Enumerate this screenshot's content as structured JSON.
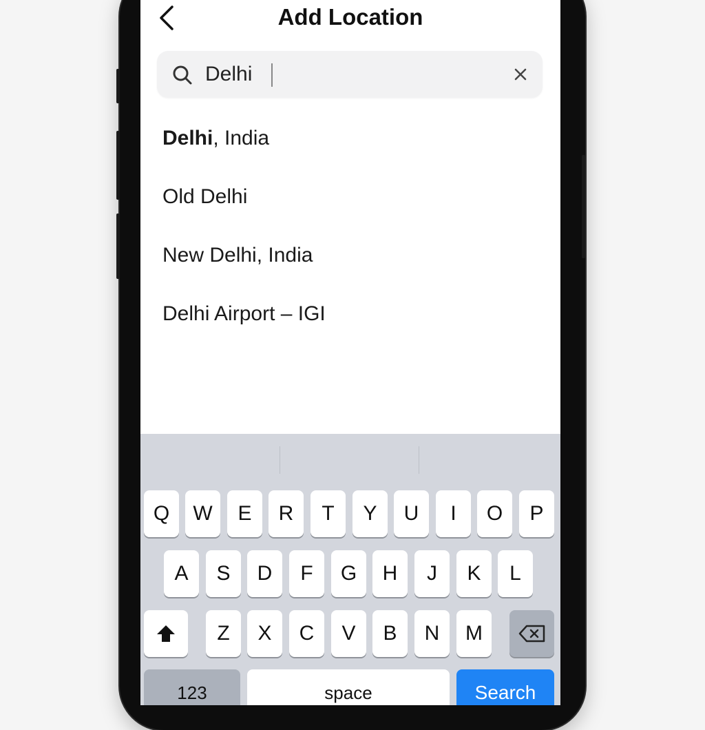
{
  "header": {
    "title": "Add Location"
  },
  "search": {
    "value": "Delhi",
    "placeholder": ""
  },
  "results": [
    {
      "bold": "Delhi",
      "rest": ", India"
    },
    {
      "bold": "",
      "rest": "Old Delhi"
    },
    {
      "bold": "",
      "rest": "New Delhi, India"
    },
    {
      "bold": "",
      "rest": "Delhi Airport – IGI"
    }
  ],
  "keyboard": {
    "row1": [
      "Q",
      "W",
      "E",
      "R",
      "T",
      "Y",
      "U",
      "I",
      "O",
      "P"
    ],
    "row2": [
      "A",
      "S",
      "D",
      "F",
      "G",
      "H",
      "J",
      "K",
      "L"
    ],
    "row3": [
      "Z",
      "X",
      "C",
      "V",
      "B",
      "N",
      "M"
    ],
    "numbers_label": "123",
    "space_label": "space",
    "search_label": "Search"
  },
  "icons": {
    "back": "chevron-left-icon",
    "search": "magnifier-icon",
    "clear": "close-icon",
    "shift": "shift-arrow-icon",
    "delete": "backspace-icon"
  },
  "colors": {
    "accent": "#1f84f5",
    "keyboard_bg": "#d3d6dd",
    "search_bg": "#f2f2f3"
  }
}
